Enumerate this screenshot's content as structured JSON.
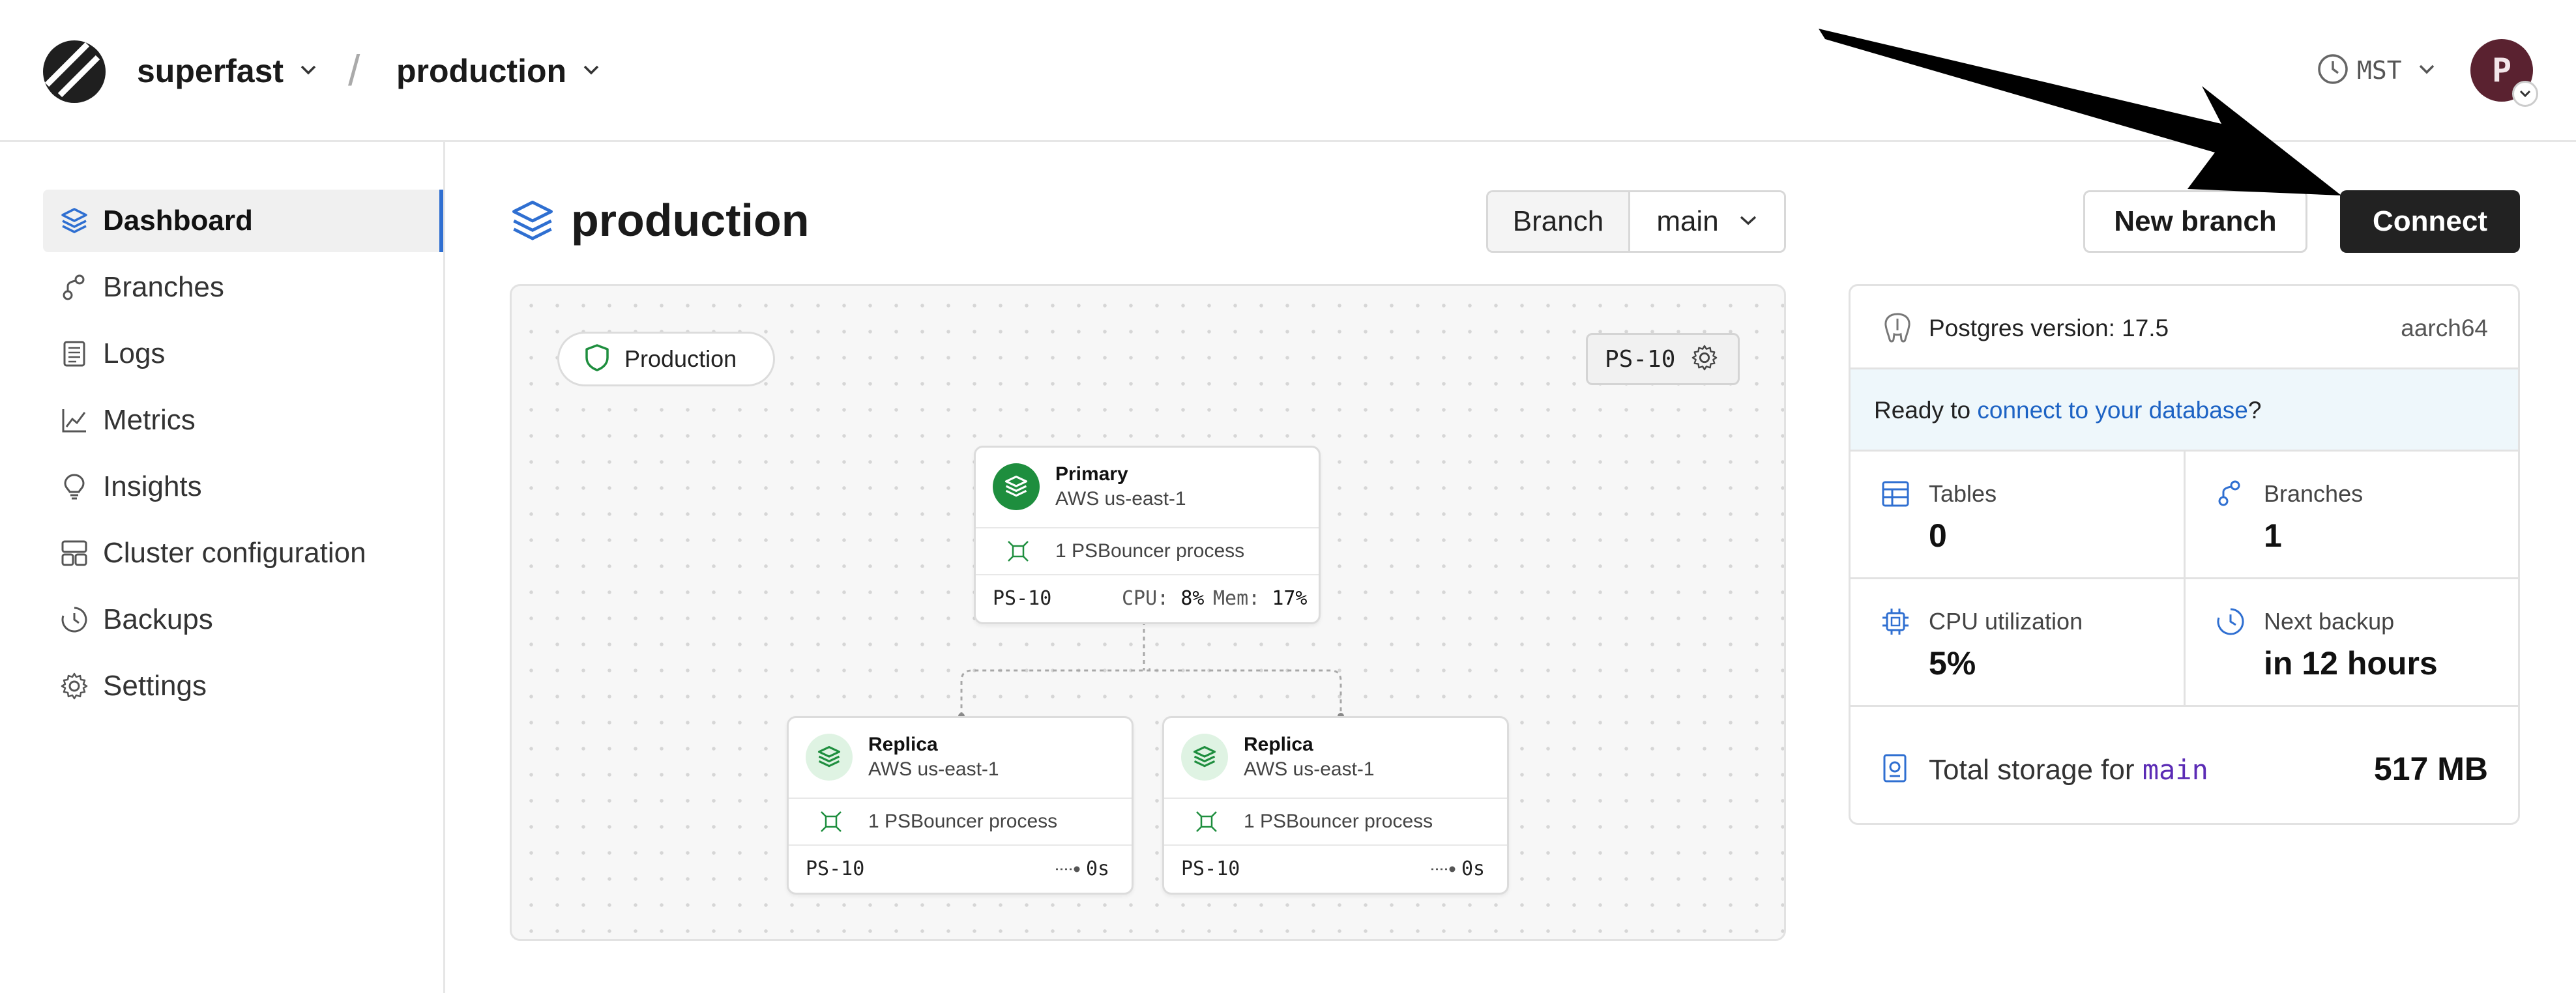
{
  "header": {
    "org": "superfast",
    "separator": "/",
    "database": "production",
    "timezone": "MST",
    "avatar_initial": "P"
  },
  "sidebar": {
    "items": [
      {
        "label": "Dashboard",
        "icon": "layers-icon",
        "active": true
      },
      {
        "label": "Branches",
        "icon": "branch-icon"
      },
      {
        "label": "Logs",
        "icon": "logs-icon"
      },
      {
        "label": "Metrics",
        "icon": "chart-line-icon"
      },
      {
        "label": "Insights",
        "icon": "lightbulb-icon"
      },
      {
        "label": "Cluster configuration",
        "icon": "cluster-icon"
      },
      {
        "label": "Backups",
        "icon": "backup-clock-icon"
      },
      {
        "label": "Settings",
        "icon": "gear-icon"
      }
    ]
  },
  "main": {
    "title": "production",
    "branch_label": "Branch",
    "branch_value": "main",
    "new_branch_label": "New branch",
    "connect_label": "Connect"
  },
  "canvas": {
    "env_badge": "Production",
    "plan_badge": "PS-10",
    "primary": {
      "title": "Primary",
      "region": "AWS us-east-1",
      "process": "1 PSBouncer process",
      "plan": "PS-10",
      "cpu_label": "CPU:",
      "cpu_value": "8%",
      "mem_label": "Mem:",
      "mem_value": "17%"
    },
    "replicas": [
      {
        "title": "Replica",
        "region": "AWS us-east-1",
        "process": "1 PSBouncer process",
        "plan": "PS-10",
        "lag": "0s"
      },
      {
        "title": "Replica",
        "region": "AWS us-east-1",
        "process": "1 PSBouncer process",
        "plan": "PS-10",
        "lag": "0s"
      }
    ]
  },
  "panel": {
    "postgres_version": "Postgres version: 17.5",
    "arch": "aarch64",
    "ready_prefix": "Ready to ",
    "ready_link": "connect to your database",
    "ready_suffix": "?",
    "stats": [
      {
        "label": "Tables",
        "value": "0",
        "icon": "table-icon"
      },
      {
        "label": "Branches",
        "value": "1",
        "icon": "branch-icon"
      },
      {
        "label": "CPU utilization",
        "value": "5%",
        "icon": "cpu-icon"
      },
      {
        "label": "Next backup",
        "value": "in 12 hours",
        "icon": "clock-icon"
      }
    ],
    "storage_label": "Total storage for ",
    "storage_branch": "main",
    "storage_value": "517 MB"
  },
  "colors": {
    "accent_blue": "#2f6fd1",
    "primary_green": "#1e8e3e",
    "replica_green_bg": "#dff3e3",
    "connect_bg": "#222222"
  }
}
